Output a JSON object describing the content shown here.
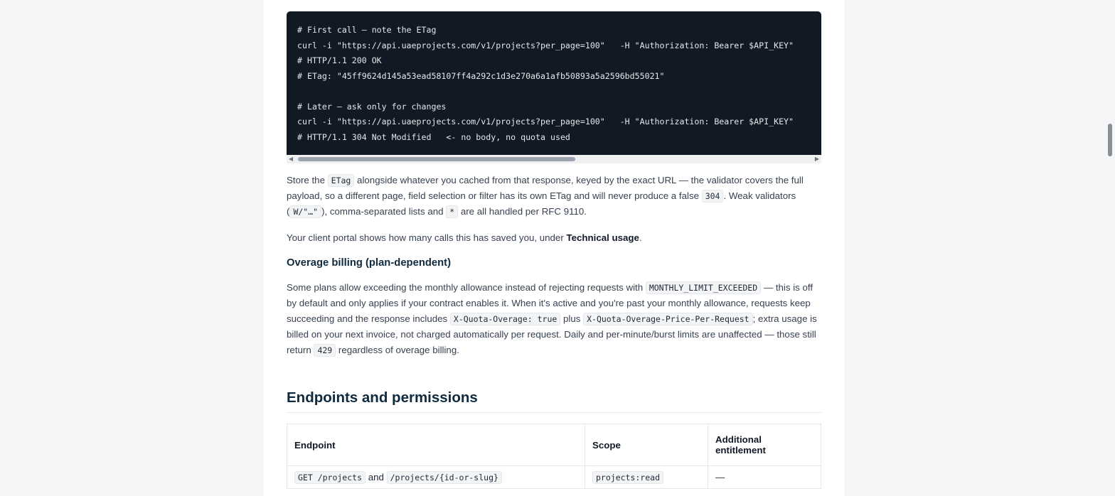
{
  "top_clip": "… /…",
  "code_block": {
    "lines": [
      "# First call — note the ETag",
      "curl -i \"https://api.uaeprojects.com/v1/projects?per_page=100\"   -H \"Authorization: Bearer $API_KEY\"",
      "# HTTP/1.1 200 OK",
      "# ETag: \"45ff9624d145a53ead58107ff4a292c1d3e270a6a1afb50893a5a2596bd55021\"",
      "",
      "# Later — ask only for changes",
      "curl -i \"https://api.uaeprojects.com/v1/projects?per_page=100\"   -H \"Authorization: Bearer $API_KEY\"",
      "# HTTP/1.1 304 Not Modified   <- no body, no quota used"
    ]
  },
  "etag_para": {
    "t1": "Store the ",
    "c1": "ETag",
    "t2": " alongside whatever you cached from that response, keyed by the exact URL — the validator covers the full payload, so a different page, field selection or filter has its own ETag and will never produce a false ",
    "c2": "304",
    "t3": ". Weak validators (",
    "c3": "W/\"…\"",
    "t4": "), comma-separated lists and ",
    "c4": "*",
    "t5": " are all handled per RFC 9110."
  },
  "portal_para": {
    "t1": "Your client portal shows how many calls this has saved you, under ",
    "strong": "Technical usage",
    "t2": "."
  },
  "overage_heading": "Overage billing (plan-dependent)",
  "overage_para": {
    "t1": "Some plans allow exceeding the monthly allowance instead of rejecting requests with ",
    "c1": "MONTHLY_LIMIT_EXCEEDED",
    "t2": " — this is off by default and only applies if your contract enables it. When it's active and you're past your monthly allowance, requests keep succeeding and the response includes ",
    "c2": "X-Quota-Overage: true",
    "t3": " plus ",
    "c3": "X-Quota-Overage-Price-Per-Request",
    "t4": "; extra usage is billed on your next invoice, not charged automatically per request. Daily and per-minute/burst limits are unaffected — those still return ",
    "c4": "429",
    "t5": " regardless of overage billing."
  },
  "endpoints_heading": "Endpoints and permissions",
  "table": {
    "headers": [
      "Endpoint",
      "Scope",
      "Additional entitlement"
    ],
    "row1": {
      "c1": "GET /projects",
      "and": " and ",
      "c2": "/projects/{id-or-slug}",
      "scope": "projects:read",
      "ent": "—"
    }
  }
}
